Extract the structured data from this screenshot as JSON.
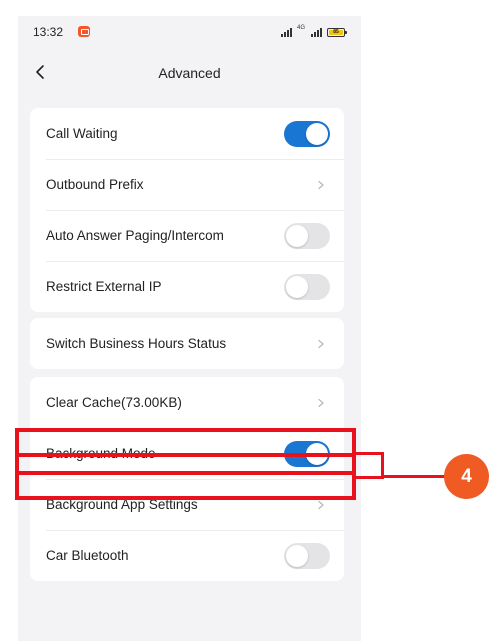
{
  "status_bar": {
    "time": "13:32",
    "network": "4G",
    "battery": "85"
  },
  "header": {
    "title": "Advanced"
  },
  "groups": [
    {
      "rows": [
        {
          "label": "Call Waiting",
          "control": "toggle",
          "on": true
        },
        {
          "label": "Outbound Prefix",
          "control": "chevron"
        },
        {
          "label": "Auto Answer Paging/Intercom",
          "control": "toggle",
          "on": false
        },
        {
          "label": "Restrict External IP",
          "control": "toggle",
          "on": false
        }
      ]
    },
    {
      "rows": [
        {
          "label": "Switch Business Hours Status",
          "control": "chevron"
        }
      ]
    },
    {
      "rows": [
        {
          "label": "Clear Cache(73.00KB)",
          "control": "chevron"
        },
        {
          "label": "Background Mode",
          "control": "toggle",
          "on": true
        },
        {
          "label": "Background App Settings",
          "control": "chevron"
        },
        {
          "label": "Car Bluetooth",
          "control": "toggle",
          "on": false
        }
      ]
    }
  ],
  "annotation": {
    "badge": "4"
  },
  "colors": {
    "toggle_on": "#1976d2",
    "toggle_off": "#e4e4e6",
    "annotation": "#e8121d",
    "badge": "#f05a23"
  }
}
